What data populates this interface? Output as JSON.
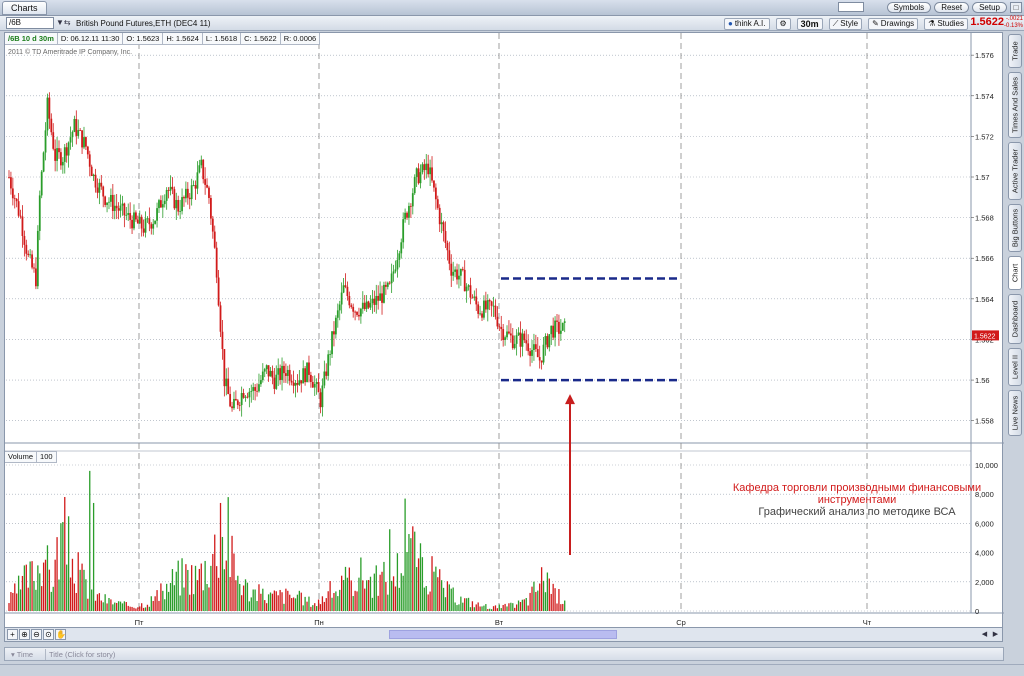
{
  "window": {
    "tab_label": "Charts",
    "buttons": [
      "Symbols",
      "Reset",
      "Setup"
    ]
  },
  "toolbar": {
    "symbol_value": "/6B",
    "symbol_description": "British Pound Futures,ETH (DEC4 11)",
    "think_ai_label": "think A.I.",
    "aggregation_label": "30m",
    "style_label": "Style",
    "drawings_label": "Drawings",
    "studies_label": "Studies",
    "last_price": "1.5622",
    "change_top": "-.0021",
    "change_bottom": "-0.13%"
  },
  "ohlc": {
    "symbol_period": "/6B 10 d 30m",
    "date": "D: 06.12.11 11:30",
    "open": "O: 1.5623",
    "high": "H: 1.5624",
    "low": "L: 1.5618",
    "close": "C: 1.5622",
    "range": "R: 0.0006"
  },
  "copyright": "2011 © TD Ameritrade IP Company, Inc.",
  "volume_header": {
    "label": "Volume",
    "period": "100"
  },
  "annotation": {
    "line1": "Кафедра торговли производными финансовыми",
    "line2": "инструментами",
    "line3": "Графический анализ по методике ВСА"
  },
  "news": {
    "time_header": "Time",
    "story_header": "Title (Click for story)"
  },
  "sidebar_tabs": [
    "Trade",
    "Times And Sales",
    "Active Trader",
    "Big Buttons",
    "Chart",
    "Dashboard",
    "Level II",
    "Live News"
  ],
  "colors": {
    "up": "#2a9d2a",
    "down": "#d11a1a",
    "support_line": "#1a2a8a",
    "arrow": "#c81e1e",
    "grid": "#9aa3b0",
    "price_marker": "#d11a1a"
  },
  "chart_data": {
    "type": "candlestick",
    "price_axis": {
      "ylim": [
        1.557,
        1.5765
      ],
      "ticks": [
        "1.576",
        "1.574",
        "1.572",
        "1.57",
        "1.568",
        "1.566",
        "1.564",
        "1.562",
        "1.56",
        "1.558"
      ]
    },
    "volume_axis": {
      "ylim": [
        0,
        10000
      ],
      "ticks": [
        "10,000",
        "8,000",
        "6,000",
        "4,000",
        "2,000",
        "0"
      ]
    },
    "x_day_labels": [
      "Пт",
      "Пн",
      "Вт",
      "Ср",
      "Чт"
    ],
    "current_price_marker": "1.5622",
    "horizontal_levels": [
      {
        "price": 1.565,
        "style": "dashed"
      },
      {
        "price": 1.56,
        "style": "dashed"
      }
    ],
    "seed_close": 1.57,
    "price_path": [
      [
        0,
        1.57
      ],
      [
        6,
        1.568
      ],
      [
        10,
        1.566
      ],
      [
        14,
        1.565
      ],
      [
        16,
        1.569
      ],
      [
        20,
        1.5735
      ],
      [
        24,
        1.571
      ],
      [
        28,
        1.571
      ],
      [
        34,
        1.5725
      ],
      [
        40,
        1.5715
      ],
      [
        44,
        1.57
      ],
      [
        50,
        1.569
      ],
      [
        56,
        1.5685
      ],
      [
        62,
        1.568
      ],
      [
        70,
        1.5675
      ],
      [
        76,
        1.568
      ],
      [
        82,
        1.5695
      ],
      [
        88,
        1.5685
      ],
      [
        96,
        1.5695
      ],
      [
        100,
        1.5705
      ],
      [
        104,
        1.569
      ],
      [
        108,
        1.5655
      ],
      [
        112,
        1.56
      ],
      [
        116,
        1.5585
      ],
      [
        122,
        1.5595
      ],
      [
        128,
        1.5595
      ],
      [
        134,
        1.5605
      ],
      [
        138,
        1.56
      ],
      [
        144,
        1.5605
      ],
      [
        150,
        1.56
      ],
      [
        156,
        1.5605
      ],
      [
        162,
        1.559
      ],
      [
        168,
        1.562
      ],
      [
        174,
        1.5645
      ],
      [
        180,
        1.5635
      ],
      [
        186,
        1.5635
      ],
      [
        192,
        1.564
      ],
      [
        198,
        1.5645
      ],
      [
        206,
        1.568
      ],
      [
        212,
        1.57
      ],
      [
        218,
        1.5705
      ],
      [
        224,
        1.568
      ],
      [
        230,
        1.5655
      ],
      [
        236,
        1.565
      ],
      [
        244,
        1.5635
      ],
      [
        252,
        1.5635
      ],
      [
        256,
        1.5625
      ],
      [
        262,
        1.562
      ],
      [
        268,
        1.562
      ],
      [
        272,
        1.5615
      ],
      [
        276,
        1.561
      ],
      [
        282,
        1.5625
      ],
      [
        286,
        1.5625
      ]
    ],
    "volume_profile": [
      [
        0,
        800
      ],
      [
        8,
        2500
      ],
      [
        14,
        3200
      ],
      [
        18,
        5000
      ],
      [
        22,
        2500
      ],
      [
        28,
        6500
      ],
      [
        34,
        3500
      ],
      [
        40,
        2200
      ],
      [
        46,
        1200
      ],
      [
        52,
        800
      ],
      [
        60,
        500
      ],
      [
        66,
        400
      ],
      [
        72,
        700
      ],
      [
        80,
        1500
      ],
      [
        86,
        2600
      ],
      [
        92,
        3000
      ],
      [
        98,
        2800
      ],
      [
        104,
        4000
      ],
      [
        110,
        6000
      ],
      [
        114,
        5200
      ],
      [
        118,
        3000
      ],
      [
        124,
        1800
      ],
      [
        130,
        1400
      ],
      [
        136,
        1200
      ],
      [
        142,
        1300
      ],
      [
        148,
        1200
      ],
      [
        154,
        900
      ],
      [
        160,
        600
      ],
      [
        166,
        1500
      ],
      [
        172,
        1900
      ],
      [
        178,
        2600
      ],
      [
        184,
        3000
      ],
      [
        190,
        2300
      ],
      [
        196,
        2800
      ],
      [
        202,
        3400
      ],
      [
        206,
        4800
      ],
      [
        210,
        4500
      ],
      [
        214,
        3600
      ],
      [
        218,
        3200
      ],
      [
        222,
        2600
      ],
      [
        228,
        1600
      ],
      [
        232,
        1100
      ],
      [
        236,
        900
      ],
      [
        244,
        500
      ],
      [
        252,
        300
      ],
      [
        262,
        450
      ],
      [
        270,
        900
      ],
      [
        276,
        2400
      ],
      [
        280,
        3000
      ],
      [
        284,
        1200
      ]
    ],
    "volume_peaks": [
      [
        42,
        9600
      ],
      [
        114,
        7800
      ],
      [
        206,
        7700
      ],
      [
        210,
        5800
      ],
      [
        198,
        5600
      ],
      [
        110,
        7400
      ],
      [
        44,
        7400
      ],
      [
        20,
        4500
      ]
    ]
  }
}
